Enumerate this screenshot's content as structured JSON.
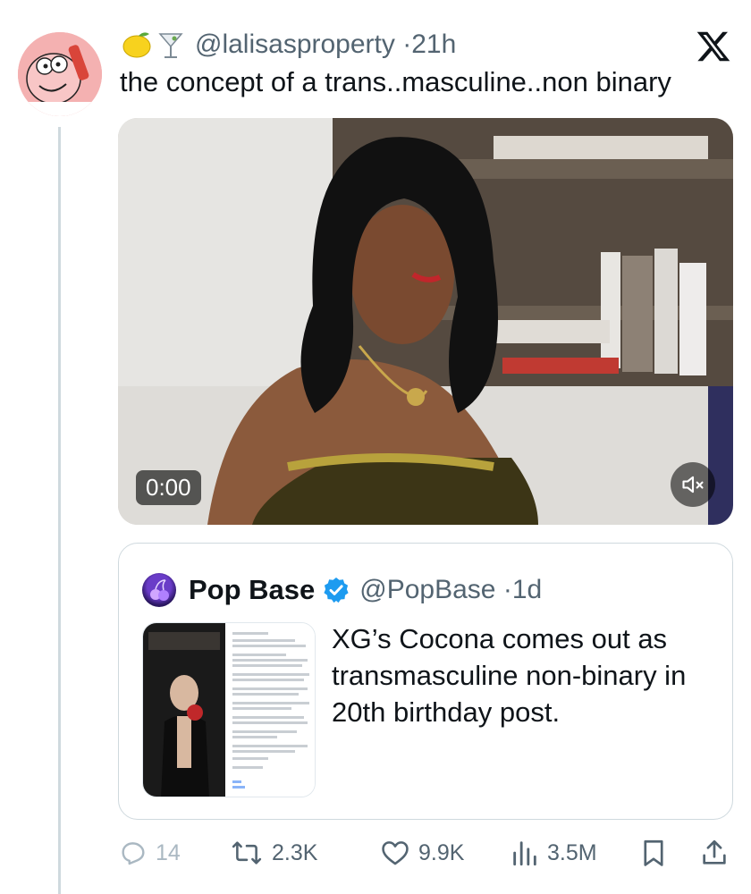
{
  "tweet": {
    "author_emojis": [
      "lemon-emoji",
      "cocktail-glass-emoji"
    ],
    "handle": "@lalisasproperty",
    "separator": "·",
    "time": "21h",
    "text": "the concept of a trans..masculine..non binary",
    "video": {
      "time": "0:00",
      "muted": true
    }
  },
  "quote": {
    "name": "Pop Base",
    "verified": true,
    "handle": "@PopBase",
    "separator": "·",
    "time": "1d",
    "text": "XG’s Cocona comes out as transmasculine non-binary in 20th birthday post."
  },
  "actions": {
    "replies": "14",
    "reposts": "2.3K",
    "likes": "9.9K",
    "views": "3.5M"
  },
  "colors": {
    "text": "#0f1419",
    "secondary": "#536471",
    "border": "#cfd9de",
    "verified": "#1d9bf0"
  }
}
